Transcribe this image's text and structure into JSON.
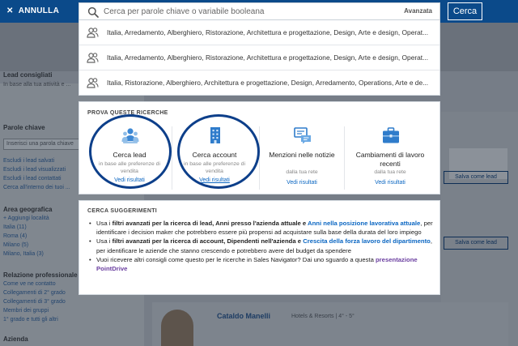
{
  "topbar": {
    "cancel_label": "ANNULLA",
    "search_button": "Cerca"
  },
  "search": {
    "placeholder": "Cerca per parole chiave o variabile booleana",
    "value": "",
    "advanced_label": "Avanzata"
  },
  "suggestions": [
    "Italia, Arredamento, Alberghiero, Ristorazione, Architettura e progettazione, Design, Arte e design, Operat...",
    "Italia, Arredamento, Alberghiero, Ristorazione, Architettura e progettazione, Design, Arte e design, Operat...",
    "Italia, Ristorazione, Alberghiero, Architettura e progettazione, Design, Arredamento, Operations, Arte e de..."
  ],
  "try_searches": {
    "title": "PROVA QUESTE RICERCHE",
    "items": [
      {
        "icon": "lead-people-icon",
        "title": "Cerca lead",
        "subtitle": "in base alle preferenze di vendita",
        "link": "Vedi risultati"
      },
      {
        "icon": "building-icon",
        "title": "Cerca account",
        "subtitle": "in base alle preferenze di vendita",
        "link": "Vedi risultati"
      },
      {
        "icon": "news-chat-icon",
        "title": "Menzioni nelle notizie",
        "subtitle": "dalla tua rete",
        "link": "Vedi risultati"
      },
      {
        "icon": "briefcase-icon",
        "title": "Cambiamenti di lavoro recenti",
        "subtitle": "dalla tua rete",
        "link": "Vedi risultati"
      }
    ]
  },
  "tips": {
    "title": "CERCA SUGGERIMENTI",
    "t1": {
      "a": "Usa i ",
      "b": "filtri avanzati per la ricerca di lead, Anni presso l'azienda attuale",
      "c": " e ",
      "link": "Anni nella posizione lavorativa attuale",
      "d": ", per identificare i decision maker che potrebbero essere più propensi ad acquistare sulla base della durata del loro impiego"
    },
    "t2": {
      "a": "Usa i ",
      "b": "filtri avanzati per la ricerca di account, Dipendenti nell'azienda",
      "c": " e ",
      "link": "Crescita della forza lavoro del dipartimento",
      "d": ", per identificare le aziende che stanno crescendo e potrebbero avere del budget da spendere"
    },
    "t3": {
      "a": "Vuoi ricevere altri consigli come questo per le ricerche in Sales Navigator? Dai uno sguardo a questa ",
      "link": "presentazione PointDrive"
    }
  },
  "background": {
    "lead_title": "Lead consigliati",
    "lead_sub": "In base alla tua attività e ...",
    "keywords_label": "Parole chiave",
    "keywords_placeholder": "Inserisci una parola chiave",
    "exclude_1": "Escludi i lead salvati",
    "exclude_2": "Escludi i lead visualizzati",
    "exclude_3": "Escludi i lead contattati",
    "exclude_4": "Cerca all'interno dei tuoi ...",
    "geo_label": "Area geografica",
    "geo_1": "+ Aggiungi località",
    "geo_2": "Italia (11)",
    "geo_3": "Roma (4)",
    "geo_4": "Milano (5)",
    "geo_5": "Milano, Italia (3)",
    "rel_label": "Relazione professionale",
    "rel_1": "Come ve ne contatto",
    "rel_2": "Collegamenti di 2° grado",
    "rel_3": "Collegamenti di 3° grado",
    "rel_4": "Membri dei gruppi",
    "rel_5": "1° grado e tutti gli altri",
    "company_label": "Azienda",
    "save_lead": "Salva come lead",
    "person_name": "Cataldo Manelli",
    "person_meta": "Hotels & Resorts | 4° - 5°"
  }
}
